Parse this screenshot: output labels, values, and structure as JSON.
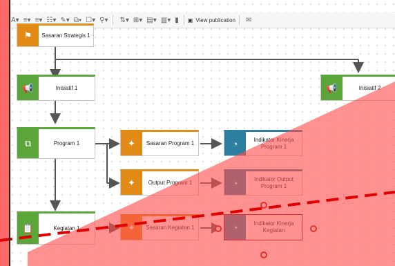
{
  "toolbar": {
    "view_publication_label": "View publication"
  },
  "nodes": {
    "sasaran_strategis": "Sasaran Strategis 1",
    "inisiatif_1": "Inisiatif 1",
    "inisiatif_2": "Inisiatif 2",
    "program_1": "Program 1",
    "sasaran_program": "Sasaran Program 1",
    "indikator_kinerja_program": "Indikator Kinerja Program 1",
    "output_program": "Output Program 1",
    "indikator_output_program": "Indikator Output Program 1",
    "kegiatan": "Kegiatan 1",
    "sasaran_kegiatan": "Sasaran Kegiatan 1",
    "indikator_kinerja_kegiatan": "Indikator Kinerja Kegiatan"
  },
  "colors": {
    "green": "#5aa63a",
    "orange": "#e28a16",
    "teal": "#2d7fa0",
    "overlay_red": "#ff4d4d",
    "dash_red": "#e00000"
  },
  "icons": {
    "strategic": "flag-icon",
    "initiative": "megaphone-icon",
    "program": "stack-clock-icon",
    "target": "target-icon",
    "indicator": "gauge-icon",
    "activity": "clipboard-icon"
  }
}
